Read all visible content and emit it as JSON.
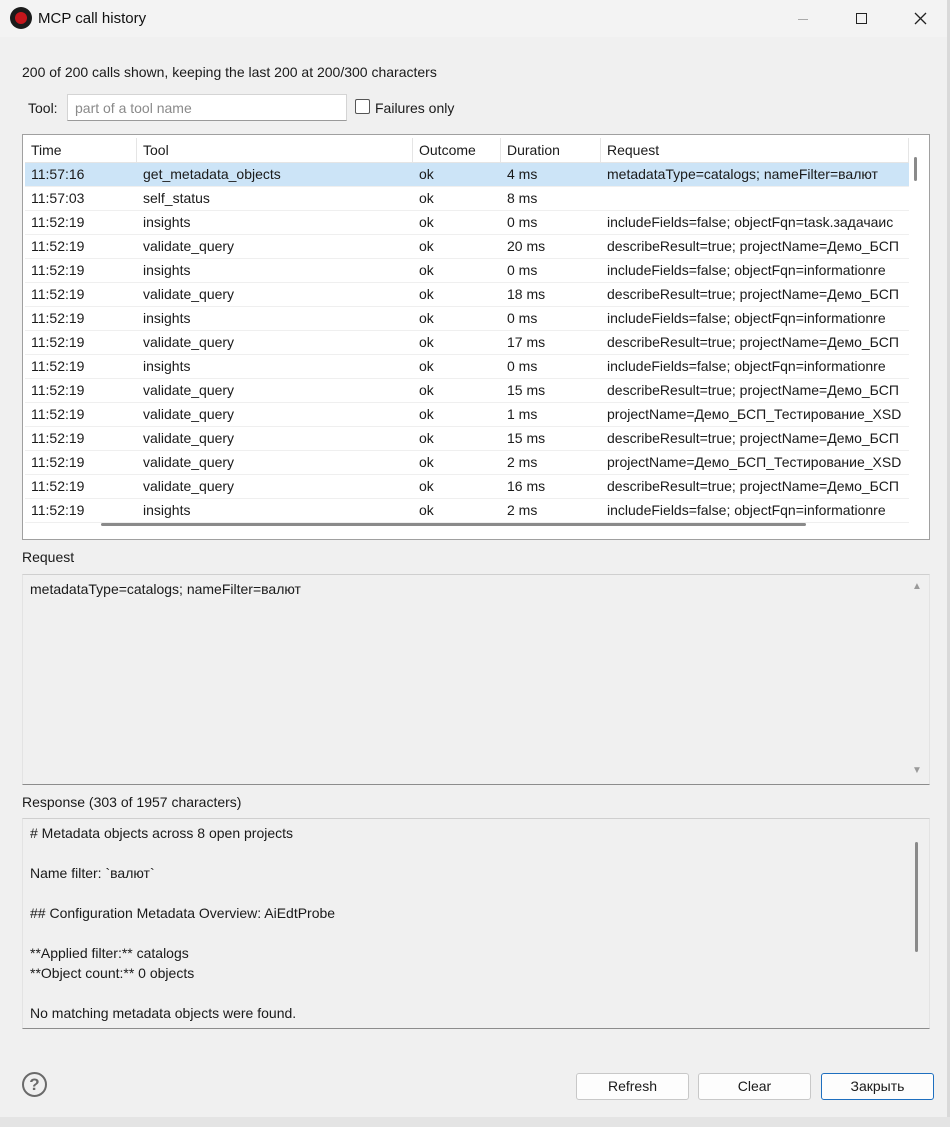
{
  "window": {
    "title": "MCP call history",
    "icon": "app-logo-icon"
  },
  "summary": "200 of 200 calls shown, keeping the last 200 at 200/300 characters",
  "filter": {
    "tool_label": "Tool:",
    "tool_placeholder": "part of a tool name",
    "tool_value": "",
    "failures_only_label": "Failures only",
    "failures_only_checked": false
  },
  "table": {
    "columns": [
      "Time",
      "Tool",
      "Outcome",
      "Duration",
      "Request"
    ],
    "rows": [
      {
        "time": "11:57:16",
        "tool": "get_metadata_objects",
        "outcome": "ok",
        "duration": "4 ms",
        "request": "metadataType=catalogs; nameFilter=валют"
      },
      {
        "time": "11:57:03",
        "tool": "self_status",
        "outcome": "ok",
        "duration": "8 ms",
        "request": ""
      },
      {
        "time": "11:52:19",
        "tool": "insights",
        "outcome": "ok",
        "duration": "0 ms",
        "request": "includeFields=false; objectFqn=task.задачаис"
      },
      {
        "time": "11:52:19",
        "tool": "validate_query",
        "outcome": "ok",
        "duration": "20 ms",
        "request": "describeResult=true; projectName=Демо_БСП"
      },
      {
        "time": "11:52:19",
        "tool": "insights",
        "outcome": "ok",
        "duration": "0 ms",
        "request": "includeFields=false; objectFqn=informationre"
      },
      {
        "time": "11:52:19",
        "tool": "validate_query",
        "outcome": "ok",
        "duration": "18 ms",
        "request": "describeResult=true; projectName=Демо_БСП"
      },
      {
        "time": "11:52:19",
        "tool": "insights",
        "outcome": "ok",
        "duration": "0 ms",
        "request": "includeFields=false; objectFqn=informationre"
      },
      {
        "time": "11:52:19",
        "tool": "validate_query",
        "outcome": "ok",
        "duration": "17 ms",
        "request": "describeResult=true; projectName=Демо_БСП"
      },
      {
        "time": "11:52:19",
        "tool": "insights",
        "outcome": "ok",
        "duration": "0 ms",
        "request": "includeFields=false; objectFqn=informationre"
      },
      {
        "time": "11:52:19",
        "tool": "validate_query",
        "outcome": "ok",
        "duration": "15 ms",
        "request": "describeResult=true; projectName=Демо_БСП"
      },
      {
        "time": "11:52:19",
        "tool": "validate_query",
        "outcome": "ok",
        "duration": "1 ms",
        "request": "projectName=Демо_БСП_Тестирование_XSD"
      },
      {
        "time": "11:52:19",
        "tool": "validate_query",
        "outcome": "ok",
        "duration": "15 ms",
        "request": "describeResult=true; projectName=Демо_БСП"
      },
      {
        "time": "11:52:19",
        "tool": "validate_query",
        "outcome": "ok",
        "duration": "2 ms",
        "request": "projectName=Демо_БСП_Тестирование_XSD"
      },
      {
        "time": "11:52:19",
        "tool": "validate_query",
        "outcome": "ok",
        "duration": "16 ms",
        "request": "describeResult=true; projectName=Демо_БСП"
      },
      {
        "time": "11:52:19",
        "tool": "insights",
        "outcome": "ok",
        "duration": "2 ms",
        "request": "includeFields=false; objectFqn=informationre"
      }
    ],
    "selected_index": 0
  },
  "request_section": {
    "label": "Request",
    "text": "metadataType=catalogs; nameFilter=валют"
  },
  "response_section": {
    "label": "Response (303 of 1957 characters)",
    "text": "# Metadata objects across 8 open projects\n\nName filter: `валют`\n\n## Configuration Metadata Overview: AiEdtProbe\n\n**Applied filter:** catalogs\n**Object count:** 0 objects\n\nNo matching metadata objects were found."
  },
  "buttons": {
    "help": "?",
    "refresh": "Refresh",
    "clear": "Clear",
    "close": "Закрыть"
  },
  "colors": {
    "selected_row": "#cce4f7",
    "default_button_border": "#1e6fbf",
    "background": "#f0f0f0"
  }
}
